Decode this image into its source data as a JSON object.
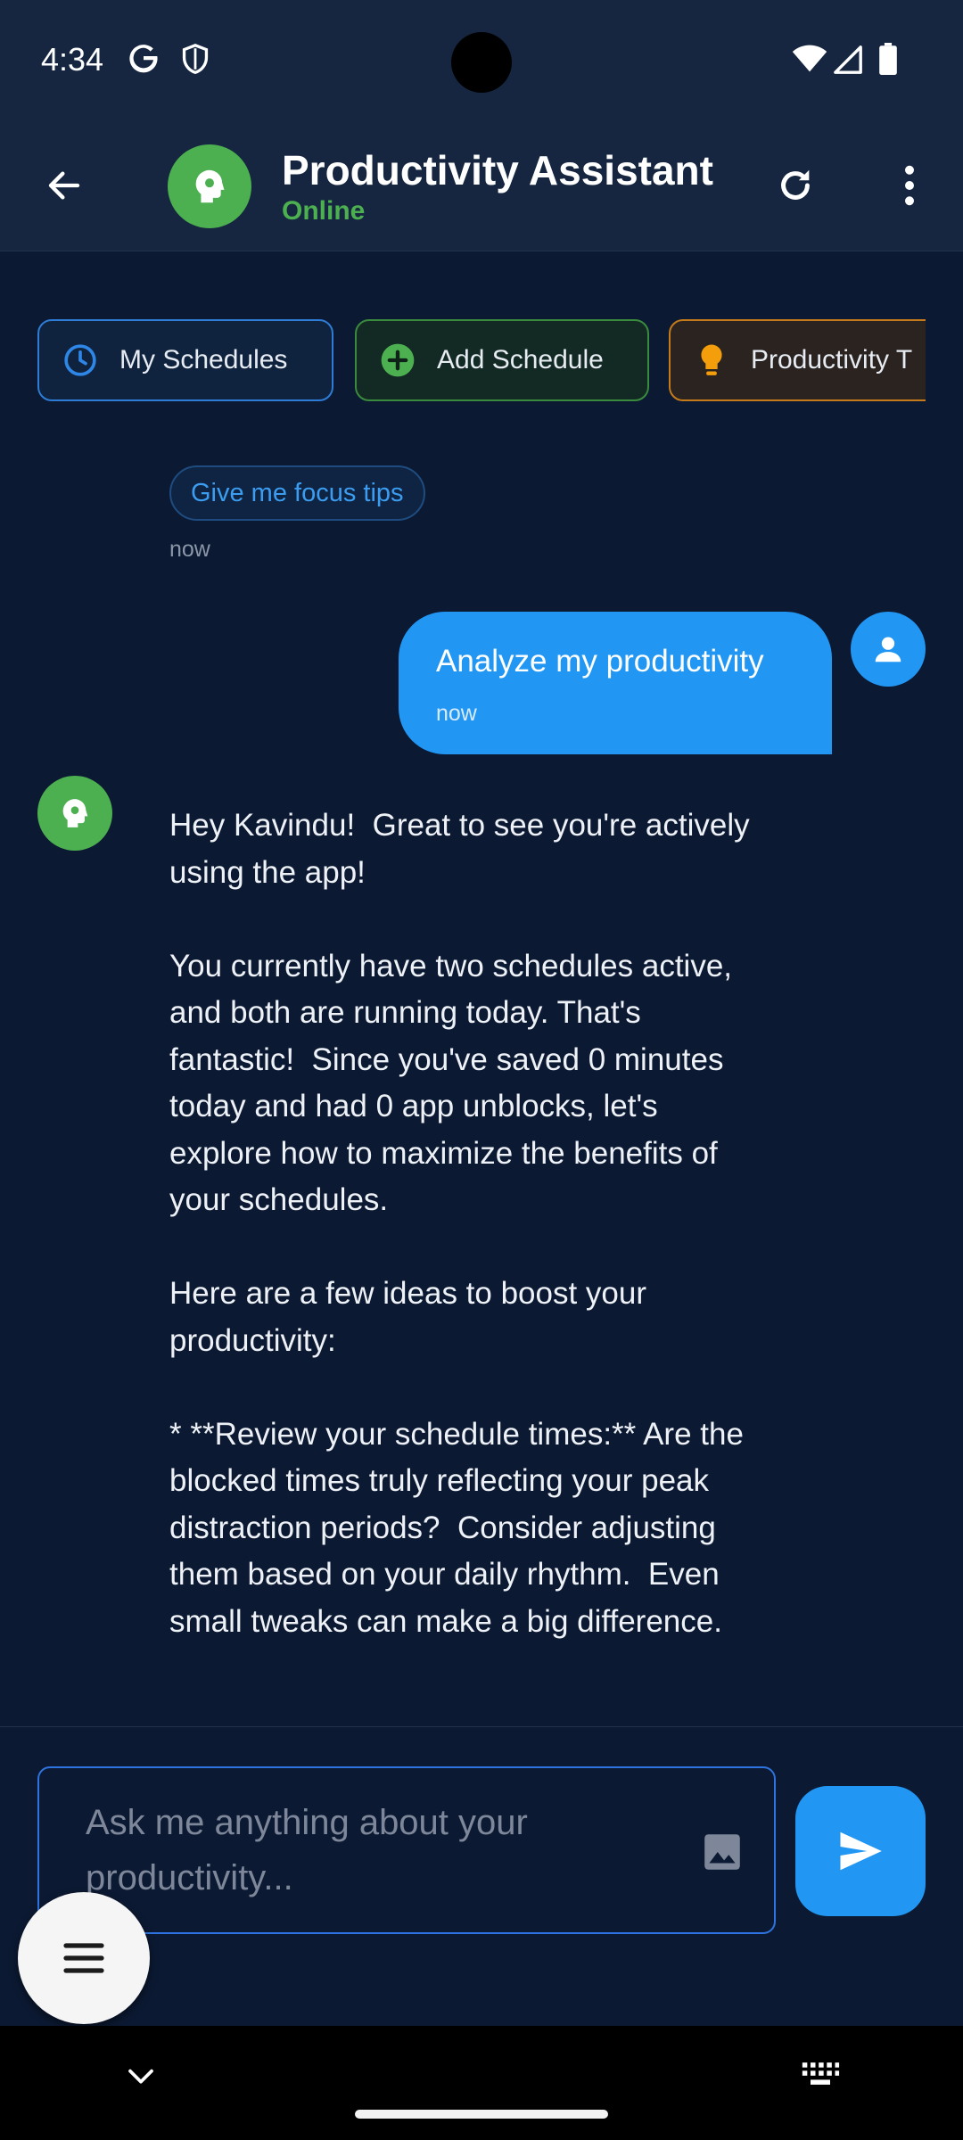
{
  "status_bar": {
    "time": "4:34",
    "icons": [
      "google-icon",
      "shield-icon",
      "wifi-icon",
      "signal-icon",
      "battery-icon"
    ]
  },
  "app_bar": {
    "title": "Productivity Assistant",
    "status": "Online",
    "actions": [
      "back-icon",
      "refresh-icon",
      "more-vert-icon"
    ]
  },
  "quick_actions": [
    {
      "label": "My Schedules",
      "icon": "clock-icon",
      "color": "#2e7cd6"
    },
    {
      "label": "Add Schedule",
      "icon": "add-circle-icon",
      "color": "#4caf50"
    },
    {
      "label": "Productivity T",
      "icon": "lightbulb-icon",
      "color": "#f59e0b"
    }
  ],
  "chat": {
    "suggestion": {
      "label": "Give me focus tips",
      "time": "now"
    },
    "user_message": {
      "text": "Analyze my productivity",
      "time": "now"
    },
    "bot_message": {
      "text": "Hey Kavindu!  Great to see you're actively using the app!\n\nYou currently have two schedules active, and both are running today. That's fantastic!  Since you've saved 0 minutes today and had 0 app unblocks, let's explore how to maximize the benefits of your schedules.\n\nHere are a few ideas to boost your productivity:\n\n* **Review your schedule times:** Are the blocked times truly reflecting your peak distraction periods?  Consider adjusting them based on your daily rhythm.  Even small tweaks can make a big difference."
    }
  },
  "composer": {
    "placeholder": "Ask me anything about your productivity..."
  },
  "colors": {
    "background": "#0b1932",
    "header": "#162640",
    "accent": "#2196f3",
    "online": "#4caf50"
  }
}
